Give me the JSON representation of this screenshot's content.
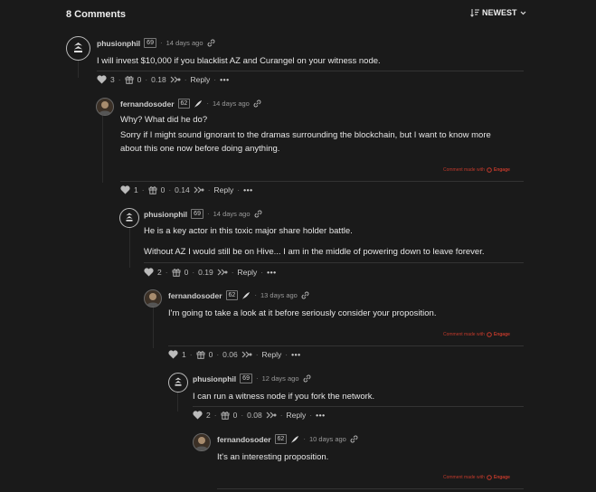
{
  "header": {
    "count": "8 Comments",
    "sort_label": "NEWEST"
  },
  "footer_label": "Comment made with",
  "footer_brand": "Engage",
  "comments": [
    {
      "author": "phusionphil",
      "rep": "69",
      "time": "14 days ago",
      "body": [
        "I will invest $10,000 if you blacklist AZ and Curangel on your witness node."
      ],
      "likes": "3",
      "gifts": "0",
      "value": "0.18",
      "reply": "Reply"
    },
    {
      "author": "fernandosoder",
      "rep": "62",
      "time": "14 days ago",
      "body": [
        "Why? What did he do?",
        "Sorry if I might sound ignorant to the dramas surrounding the blockchain, but I want to know more",
        "about this one now before doing anything."
      ],
      "likes": "1",
      "gifts": "0",
      "value": "0.14",
      "reply": "Reply"
    },
    {
      "author": "phusionphil",
      "rep": "69",
      "time": "14 days ago",
      "body": [
        "He is a key actor in this toxic major share holder battle.",
        "Without AZ I would still be on Hive... I am in the middle of powering down to leave forever."
      ],
      "likes": "2",
      "gifts": "0",
      "value": "0.19",
      "reply": "Reply"
    },
    {
      "author": "fernandosoder",
      "rep": "62",
      "time": "13 days ago",
      "body": [
        "I'm going to take a look at it before seriously consider your proposition."
      ],
      "likes": "1",
      "gifts": "0",
      "value": "0.06",
      "reply": "Reply"
    },
    {
      "author": "phusionphil",
      "rep": "69",
      "time": "12 days ago",
      "body": [
        "I can run a witness node if you fork the network."
      ],
      "likes": "2",
      "gifts": "0",
      "value": "0.08",
      "reply": "Reply"
    },
    {
      "author": "fernandosoder",
      "rep": "62",
      "time": "10 days ago",
      "body": [
        "It's an interesting proposition."
      ]
    }
  ]
}
